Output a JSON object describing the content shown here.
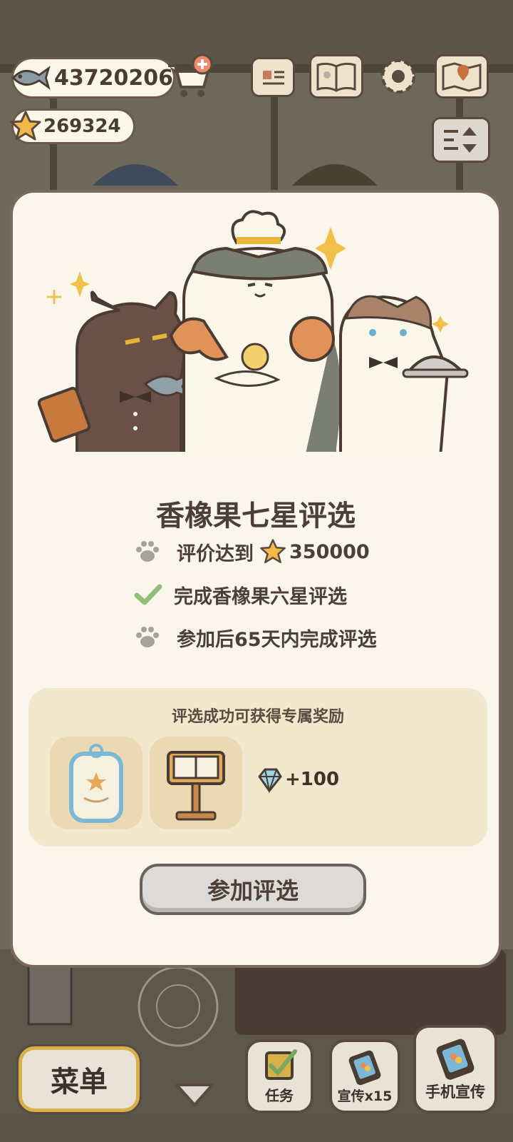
{
  "hud": {
    "fish_count": "43720206",
    "star_count": "269324"
  },
  "modal": {
    "title": "香橡果七星评选",
    "requirements": [
      {
        "text": "评价达到",
        "value": "350000",
        "status": "pending"
      },
      {
        "text": "完成香橡果六星评选",
        "status": "done"
      },
      {
        "text": "参加后65天内完成评选",
        "status": "pending"
      }
    ],
    "reward_title": "评选成功可获得专属奖励",
    "gem_reward": "+100",
    "join_button": "参加评选"
  },
  "bottom": {
    "menu_label": "菜单",
    "tasks_label": "任务",
    "promo_label": "宣传x15",
    "phone_promo_label": "手机宣传"
  },
  "colors": {
    "accent_check": "#8fbf78",
    "paw": "#a8a29c",
    "gold_star": "#f2b84a"
  }
}
